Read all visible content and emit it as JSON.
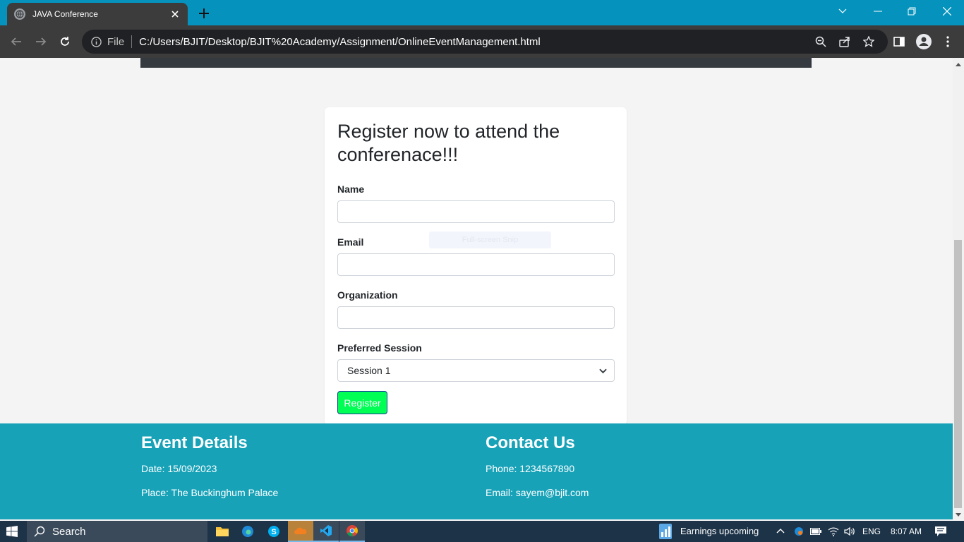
{
  "browser": {
    "tab_title": "JAVA Conference",
    "file_label": "File",
    "url": "C:/Users/BJIT/Desktop/BJIT%20Academy/Assignment/OnlineEventManagement.html"
  },
  "form": {
    "heading": "Register now to attend the conferenace!!!",
    "name_label": "Name",
    "email_label": "Email",
    "organization_label": "Organization",
    "session_label": "Preferred Session",
    "session_value": "Session 1",
    "register_label": "Register"
  },
  "snip_overlay": "Full-screen Snip",
  "footer": {
    "event_heading": "Event Details",
    "date": "Date: 15/09/2023",
    "place": "Place: The Buckinghum Palace",
    "contact_heading": "Contact Us",
    "phone": "Phone: 1234567890",
    "email": "Email: sayem@bjit.com"
  },
  "taskbar": {
    "search_label": "Search",
    "news": "Earnings upcoming",
    "language": "ENG",
    "time": "8:07 AM"
  },
  "colors": {
    "tabstrip": "#0593bd",
    "footer": "#17a2b8",
    "register_button": "#00ff55"
  }
}
